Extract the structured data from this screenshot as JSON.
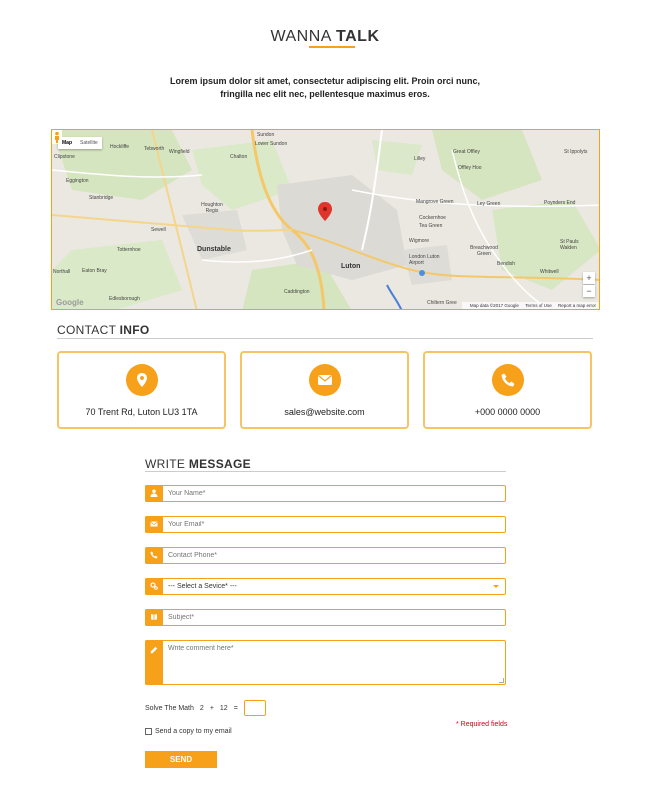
{
  "header": {
    "title_light": "WANNA",
    "title_bold": "TALK",
    "intro_line1": "Lorem ipsum dolor sit amet, consectetur adipiscing elit. Proin orci nunc,",
    "intro_line2": "fringilla nec elit nec, pellentesque maximus eros."
  },
  "map": {
    "type_map": "Map",
    "type_satellite": "Satellite",
    "zoom_in": "+",
    "zoom_out": "−",
    "attribution": "Map data ©2017 Google",
    "terms": "Terms of Use",
    "report": "Report a map error",
    "logo": "Google",
    "labels": {
      "sundon": "Sundon",
      "lower_sundon": "Lower Sundon",
      "hockliffe": "Hockliffe",
      "tebworth": "Tebworth",
      "wingfield": "Wingfield",
      "chalton": "Chalton",
      "clipstone": "Clipstone",
      "eggington": "Eggington",
      "stanbridge": "Stanbridge",
      "houghton_regis": "Houghton Regis",
      "sewell": "Sewell",
      "dunstable": "Dunstable",
      "totternhoe": "Totternhoe",
      "northall": "Northall",
      "eaton_bray": "Eaton Bray",
      "edlesborough": "Edlesborough",
      "caddington": "Caddington",
      "luton": "Luton",
      "lilley": "Lilley",
      "great_offley": "Great Offley",
      "offley_hoo": "Offley Hoo",
      "st_ippolyts": "St Ippolyts",
      "mangrove_green": "Mangrove Green",
      "cockernhoe": "Cockernhoe",
      "tea_green": "Tea Green",
      "ley_green": "Ley Green",
      "poynders_end": "Poynders End",
      "wigmore": "Wigmore",
      "luton_airport": "London Luton Airport",
      "breachwood_green": "Breachwood Green",
      "bendish": "Bendish",
      "st_pauls_walden": "St Pauls Walden",
      "whitwell": "Whitwell",
      "chiltern_green": "Chiltern Gree"
    }
  },
  "contact_info": {
    "title_light": "CONTACT",
    "title_bold": "INFO",
    "cards": [
      {
        "icon": "location-pin-icon",
        "text": "70 Trent Rd, Luton LU3 1TA"
      },
      {
        "icon": "envelope-icon",
        "text": "sales@website.com"
      },
      {
        "icon": "phone-icon",
        "text": "+000 0000 0000"
      }
    ]
  },
  "form": {
    "title_light": "WRITE",
    "title_bold": "MESSAGE",
    "name_placeholder": "Your Name*",
    "email_placeholder": "Your Email*",
    "phone_placeholder": "Contact Phone*",
    "service_selected": "--- Select a Sevice* ---",
    "subject_placeholder": "Subject*",
    "comment_placeholder": "Write comment here*",
    "math_label": "Solve The Math",
    "math_a": "2",
    "math_op": "+",
    "math_b": "12",
    "math_eq": "=",
    "required_note": "* Required fields",
    "copy_label": "Send a copy to my email",
    "send_label": "SEND"
  },
  "colors": {
    "accent": "#f7a11a",
    "required": "#d0021b"
  }
}
